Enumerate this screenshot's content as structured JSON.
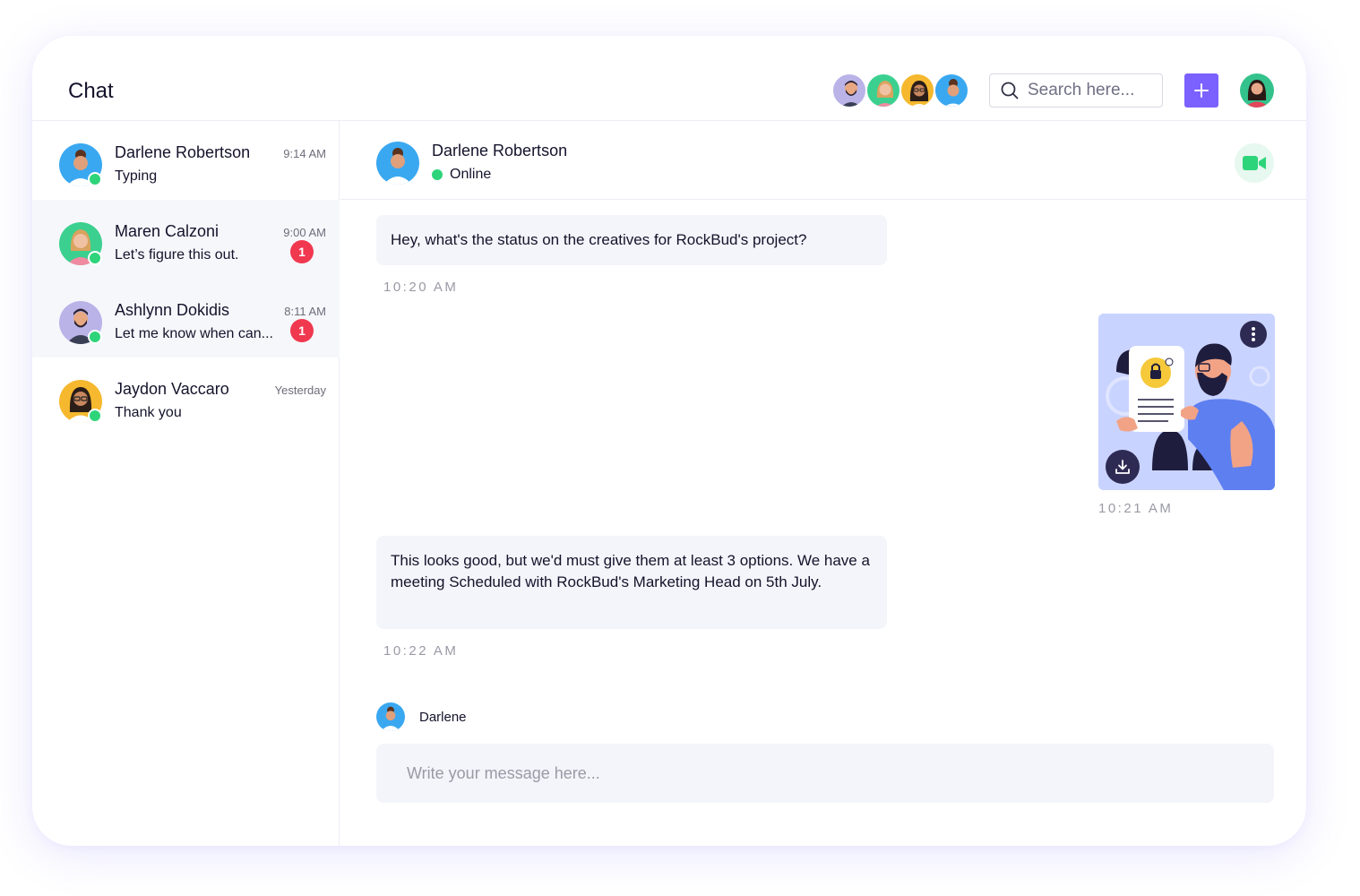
{
  "header": {
    "title": "Chat",
    "search_placeholder": "Search here...",
    "add_icon": "plus-icon",
    "search_icon": "search-icon"
  },
  "colors": {
    "accent": "#7b61ff",
    "online": "#2ed47a",
    "badge": "#f0384f",
    "bubble": "#f4f5fa",
    "video_bg": "#e6f8ef"
  },
  "conversations": [
    {
      "name": "Darlene Robertson",
      "preview": "Typing",
      "time": "9:14 AM",
      "unread": ""
    },
    {
      "name": "Maren Calzoni",
      "preview": "Let’s figure this out.",
      "time": "9:00 AM",
      "unread": "1"
    },
    {
      "name": "Ashlynn Dokidis",
      "preview": "Let me know when can...",
      "time": "8:11 AM",
      "unread": "1"
    },
    {
      "name": "Jaydon Vaccaro",
      "preview": "Thank you",
      "time": "Yesterday",
      "unread": ""
    }
  ],
  "chat": {
    "contact_name": "Darlene Robertson",
    "contact_status": "Online",
    "video_icon": "video-camera-icon",
    "messages": [
      {
        "text": "Hey, what's the status on the creatives for RockBud's project?",
        "time": "10:20 AM"
      },
      {
        "image": "document-lock-illustration",
        "time": "10:21 AM"
      },
      {
        "text": "This looks good, but we'd must give them at least 3 options. We have a meeting Scheduled with RockBud's Marketing Head on 5th July.",
        "time": "10:22 AM"
      }
    ],
    "typing_name": "Darlene",
    "composer_placeholder": "Write your message here..."
  }
}
